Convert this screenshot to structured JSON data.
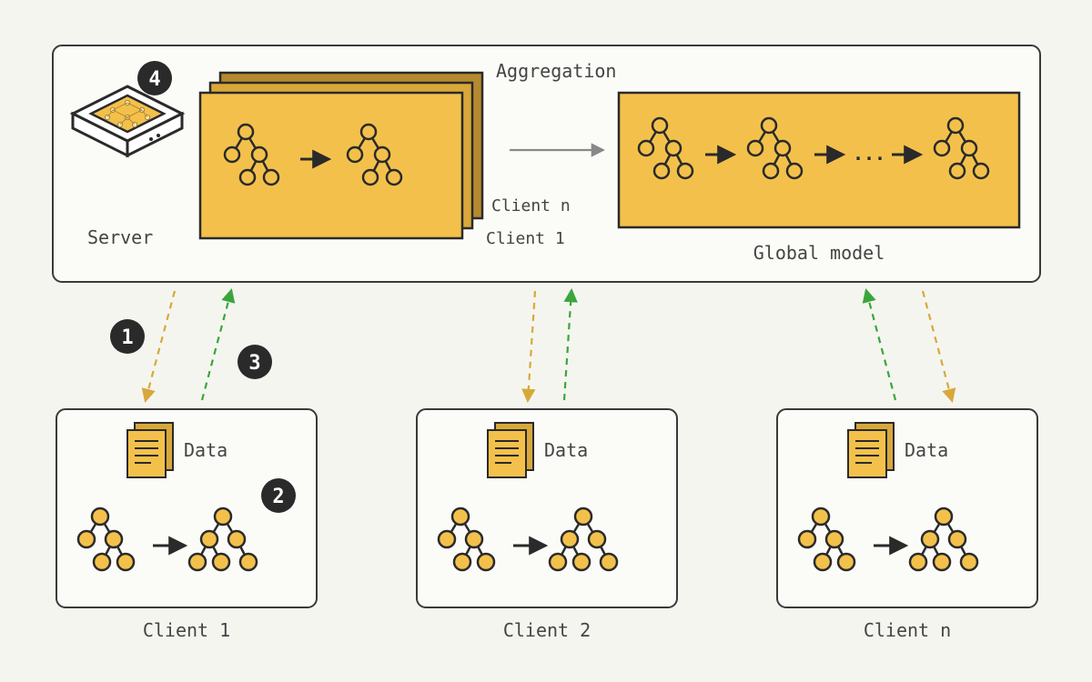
{
  "labels": {
    "server": "Server",
    "aggregation": "Aggregation",
    "client_n_tag": "Client n",
    "client_1_tag": "Client 1",
    "global_model": "Global model",
    "data": "Data",
    "client1": "Client 1",
    "client2": "Client 2",
    "clientn": "Client n",
    "ellipsis": "..."
  },
  "steps": {
    "s1": "1",
    "s2": "2",
    "s3": "3",
    "s4": "4"
  },
  "colors": {
    "dark": "#2a2a2a",
    "border": "#3a3a3a",
    "amber": "#f3c14b",
    "amberDark": "#d8a83a",
    "amberDeep": "#b58a2e",
    "panel": "#fbfbf8",
    "text": "#444",
    "green": "#3aa63a",
    "gray": "#888"
  }
}
